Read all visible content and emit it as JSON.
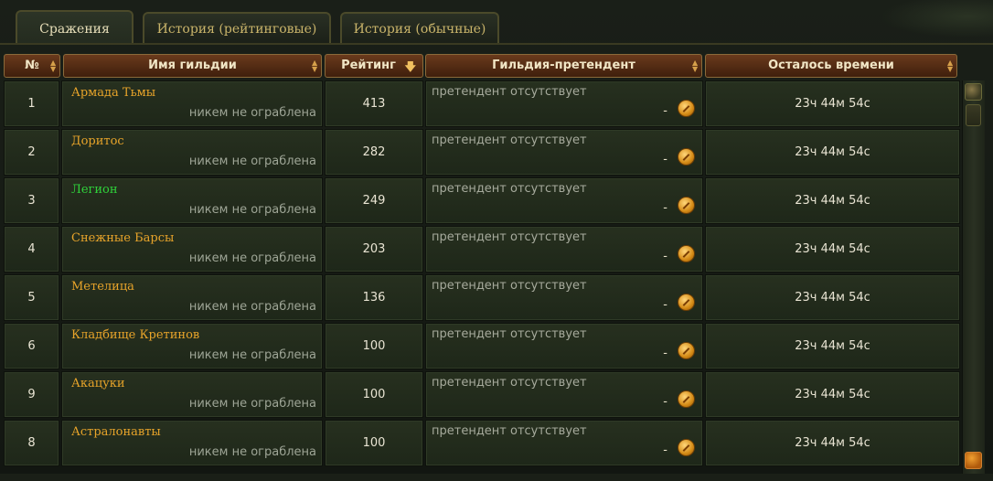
{
  "tabs": [
    {
      "label": "Сражения",
      "active": true
    },
    {
      "label": "История (рейтинговые)",
      "active": false
    },
    {
      "label": "История (обычные)",
      "active": false
    }
  ],
  "columns": {
    "num": "№",
    "name": "Имя гильдии",
    "rating": "Рейтинг",
    "pretender": "Гильдия-претендент",
    "time": "Осталось времени"
  },
  "rows": [
    {
      "num": "1",
      "name": "Армада Тьмы",
      "status": "никем не ограблена",
      "rating": "413",
      "pretender": "претендент отсутствует",
      "dash": "-",
      "time": "23ч 44м 54с"
    },
    {
      "num": "2",
      "name": "Доритос",
      "status": "никем не ограблена",
      "rating": "282",
      "pretender": "претендент отсутствует",
      "dash": "-",
      "time": "23ч 44м 54с"
    },
    {
      "num": "3",
      "name": "Легион",
      "status": "никем не ограблена",
      "rating": "249",
      "pretender": "претендент отсутствует",
      "dash": "-",
      "time": "23ч 44м 54с"
    },
    {
      "num": "4",
      "name": "Снежные Барсы",
      "status": "никем не ограблена",
      "rating": "203",
      "pretender": "претендент отсутствует",
      "dash": "-",
      "time": "23ч 44м 54с"
    },
    {
      "num": "5",
      "name": "Метелица",
      "status": "никем не ограблена",
      "rating": "136",
      "pretender": "претендент отсутствует",
      "dash": "-",
      "time": "23ч 44м 54с"
    },
    {
      "num": "6",
      "name": "Кладбище Кретинов",
      "status": "никем не ограблена",
      "rating": "100",
      "pretender": "претендент отсутствует",
      "dash": "-",
      "time": "23ч 44м 54с"
    },
    {
      "num": "9",
      "name": "Акацуки",
      "status": "никем не ограблена",
      "rating": "100",
      "pretender": "претендент отсутствует",
      "dash": "-",
      "time": "23ч 44м 54с"
    },
    {
      "num": "8",
      "name": "Астралонавты",
      "status": "никем не ограблена",
      "rating": "100",
      "pretender": "претендент отсутствует",
      "dash": "-",
      "time": "23ч 44м 54с"
    }
  ],
  "colors": {
    "guild_name": "#e8a42a",
    "guild_name_highlight": "#2fd23a",
    "header_bg": "#5a2f14"
  }
}
